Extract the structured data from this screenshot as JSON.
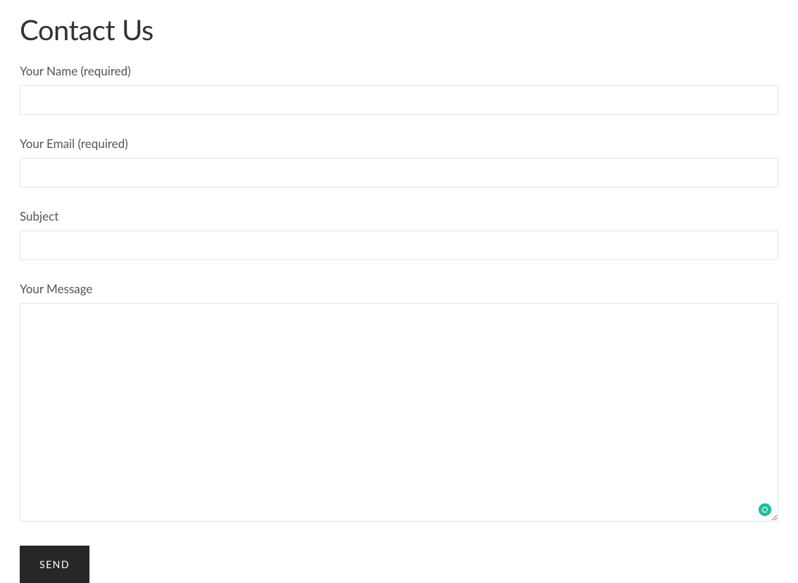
{
  "page": {
    "title": "Contact Us"
  },
  "form": {
    "name": {
      "label": "Your Name (required)",
      "value": ""
    },
    "email": {
      "label": "Your Email (required)",
      "value": ""
    },
    "subject": {
      "label": "Subject",
      "value": ""
    },
    "message": {
      "label": "Your Message",
      "value": ""
    },
    "submit_label": "SEND"
  }
}
